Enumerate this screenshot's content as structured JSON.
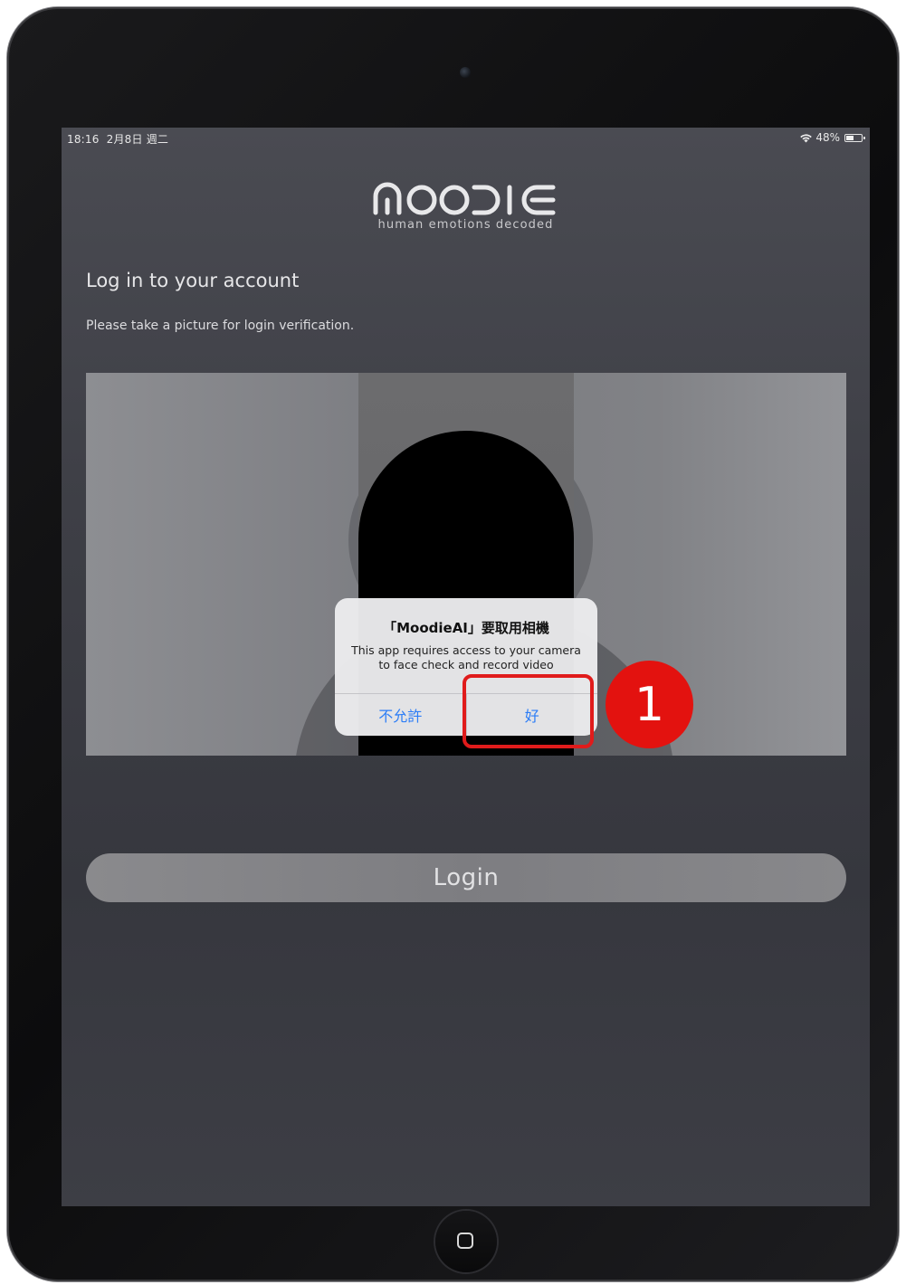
{
  "status_bar": {
    "time": "18:16",
    "date": "2月8日 週二",
    "battery_percent": "48%",
    "battery_level": 0.48,
    "icons": [
      "wifi-icon",
      "battery-icon"
    ]
  },
  "logo": {
    "wordmark": "MOODIE",
    "tagline": "human emotions decoded"
  },
  "login": {
    "heading": "Log in to your account",
    "instruction": "Please take a picture for login verification.",
    "button_label": "Login"
  },
  "alert": {
    "title": "「MoodieAI」要取用相機",
    "message": "This app requires access to your camera to face check and record video",
    "deny_label": "不允許",
    "allow_label": "好"
  },
  "annotation": {
    "step_number": "1",
    "highlight_color": "#e01b1b"
  },
  "colors": {
    "alert_button_text": "#2c7df6",
    "step_badge": "#e3120f"
  }
}
